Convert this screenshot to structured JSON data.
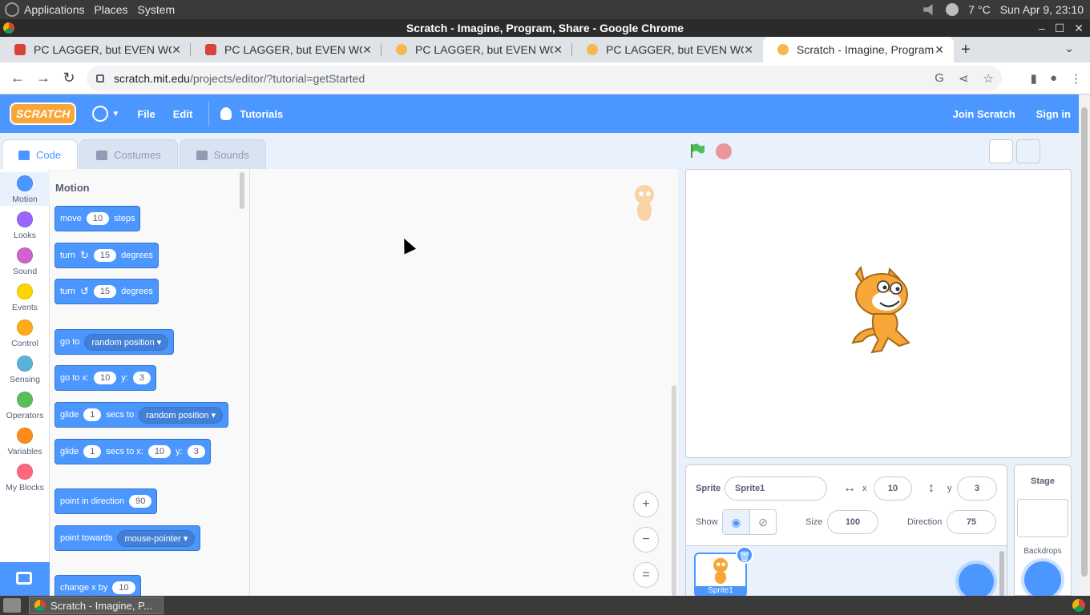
{
  "system": {
    "menus": [
      "Applications",
      "Places",
      "System"
    ],
    "weather": "7 °C",
    "clock": "Sun Apr  9, 23:10"
  },
  "window": {
    "title": "Scratch - Imagine, Program, Share - Google Chrome"
  },
  "tabs": [
    {
      "title": "PC LAGGER, but EVEN WORSE",
      "close": "✕"
    },
    {
      "title": "PC LAGGER, but EVEN WORSE",
      "close": "✕"
    },
    {
      "title": "PC LAGGER, but EVEN WORSE",
      "close": "✕"
    },
    {
      "title": "PC LAGGER, but EVEN WORSE",
      "close": "✕"
    },
    {
      "title": "Scratch - Imagine, Program, Share",
      "close": "✕"
    }
  ],
  "address": {
    "host": "scratch.mit.edu",
    "path": "/projects/editor/?tutorial=getStarted"
  },
  "scratch_menu": {
    "logo": "SCRATCH",
    "file": "File",
    "edit": "Edit",
    "tutorials": "Tutorials",
    "join": "Join Scratch",
    "signin": "Sign in"
  },
  "editor_tabs": {
    "code": "Code",
    "costumes": "Costumes",
    "sounds": "Sounds"
  },
  "categories": [
    {
      "label": "Motion",
      "color": "#4c97ff"
    },
    {
      "label": "Looks",
      "color": "#9966ff"
    },
    {
      "label": "Sound",
      "color": "#cf63cf"
    },
    {
      "label": "Events",
      "color": "#ffd500"
    },
    {
      "label": "Control",
      "color": "#ffab19"
    },
    {
      "label": "Sensing",
      "color": "#5cb1d6"
    },
    {
      "label": "Operators",
      "color": "#59c059"
    },
    {
      "label": "Variables",
      "color": "#ff8c1a"
    },
    {
      "label": "My Blocks",
      "color": "#ff6680"
    }
  ],
  "palette": {
    "heading": "Motion",
    "move": {
      "a": "move",
      "v": "10",
      "b": "steps"
    },
    "turn_right": {
      "a": "turn",
      "v": "15",
      "b": "degrees"
    },
    "turn_left": {
      "a": "turn",
      "v": "15",
      "b": "degrees"
    },
    "goto": {
      "a": "go to",
      "opt": "random position"
    },
    "gotoxy": {
      "a": "go to x:",
      "x": "10",
      "yl": "y:",
      "y": "3"
    },
    "glide": {
      "a": "glide",
      "v": "1",
      "b": "secs to",
      "opt": "random position"
    },
    "glidexy": {
      "a": "glide",
      "v": "1",
      "b": "secs to x:",
      "x": "10",
      "yl": "y:",
      "y": "3"
    },
    "point_dir": {
      "a": "point in direction",
      "v": "90"
    },
    "point_towards": {
      "a": "point towards",
      "opt": "mouse-pointer"
    },
    "change_x": {
      "a": "change x by",
      "v": "10"
    }
  },
  "sprite_info": {
    "sprite_label": "Sprite",
    "sprite_name": "Sprite1",
    "x_label": "x",
    "x": "10",
    "y_label": "y",
    "y": "3",
    "show_label": "Show",
    "size_label": "Size",
    "size": "100",
    "direction_label": "Direction",
    "direction": "75",
    "thumb_name": "Sprite1"
  },
  "stage_pane": {
    "title": "Stage",
    "backdrops": "Backdrops"
  },
  "taskbar": {
    "task": "Scratch - Imagine, P..."
  }
}
